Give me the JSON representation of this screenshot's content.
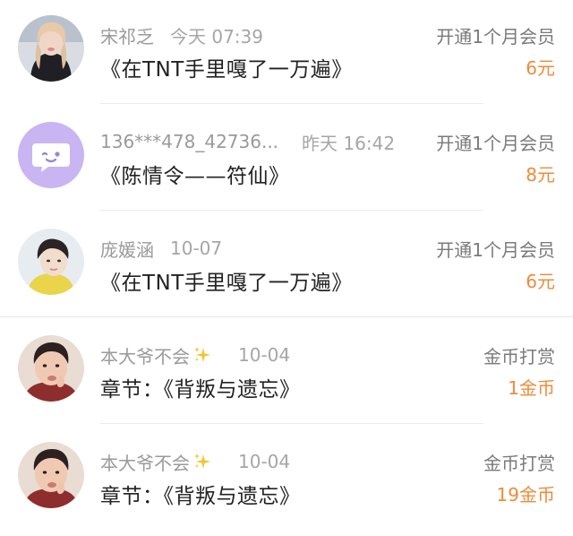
{
  "colors": {
    "amount": "#ee8b3a",
    "secondary_text": "#9a9a9a",
    "primary_text": "#222222",
    "divider": "#ececec"
  },
  "records": [
    {
      "username": "宋祁乏",
      "time": "今天 07:39",
      "title": "《在TNT手里嘎了一万遍》",
      "action": "开通1个月会员",
      "amount": "6元",
      "avatar": "photo-avatar-dark-hair"
    },
    {
      "username": "136***478_42736...",
      "time": "昨天 16:42",
      "title": "《陈情令——符仙》",
      "action": "开通1个月会员",
      "amount": "8元",
      "avatar": "default-chat-bubble-avatar"
    },
    {
      "username": "庞媛涵",
      "time": "10-07",
      "title": "《在TNT手里嘎了一万遍》",
      "action": "开通1个月会员",
      "amount": "6元",
      "avatar": "photo-avatar-yellow-shirt"
    },
    {
      "username": "本大爷不会",
      "time": "10-04",
      "title": "章节：《背叛与遗忘》",
      "action": "金币打赏",
      "amount": "1金币",
      "avatar": "photo-avatar-selfie",
      "sparkle": "sparkle-icon"
    },
    {
      "username": "本大爷不会",
      "time": "10-04",
      "title": "章节：《背叛与遗忘》",
      "action": "金币打赏",
      "amount": "19金币",
      "avatar": "photo-avatar-selfie",
      "sparkle": "sparkle-icon"
    }
  ]
}
